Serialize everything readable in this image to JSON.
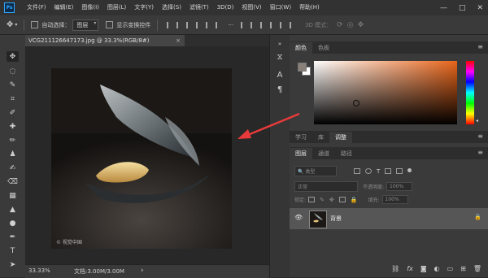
{
  "app": {
    "logo_text": "Ps"
  },
  "menu": [
    "文件(F)",
    "编辑(E)",
    "图像(I)",
    "图层(L)",
    "文字(Y)",
    "选择(S)",
    "滤镜(T)",
    "3D(D)",
    "视图(V)",
    "窗口(W)",
    "帮助(H)"
  ],
  "window_controls": {
    "minimize": "—",
    "maximize": "□",
    "close": "✕"
  },
  "options_bar": {
    "auto_select_label": "自动选择：",
    "auto_select_value": "图层",
    "transform_controls_label": "显示变换控件",
    "mode_3d_label": "3D 模式："
  },
  "document": {
    "tab_title": "VCG211126647173.jpg @ 33.3%(RGB/8#)",
    "tab_close": "×",
    "zoom": "33.33%",
    "doc_info": "文档:3.00M/3.00M",
    "status_arrow": "›",
    "watermark": "© 视觉中国"
  },
  "color_panel": {
    "tabs": [
      "颜色",
      "色板"
    ],
    "active_tab": 0,
    "foreground_color": "#8a807a",
    "background_color": "#ffffff"
  },
  "learn_panel": {
    "tabs": [
      "学习",
      "库",
      "调整"
    ],
    "active_tab": 2
  },
  "layers_panel": {
    "tabs": [
      "图层",
      "通道",
      "路径"
    ],
    "active_tab": 0,
    "filter_kind": "类型",
    "blend_mode": "正常",
    "opacity_label": "不透明度:",
    "opacity_value": "100%",
    "lock_label": "锁定:",
    "fill_label": "填充:",
    "fill_value": "100%",
    "layers": [
      {
        "name": "背景",
        "visible": true,
        "locked": true
      }
    ]
  },
  "colors": {
    "menubar": "#323232",
    "panel": "#3a3a3a",
    "canvas_bg": "#282828",
    "arrow": "#e83a3a"
  }
}
